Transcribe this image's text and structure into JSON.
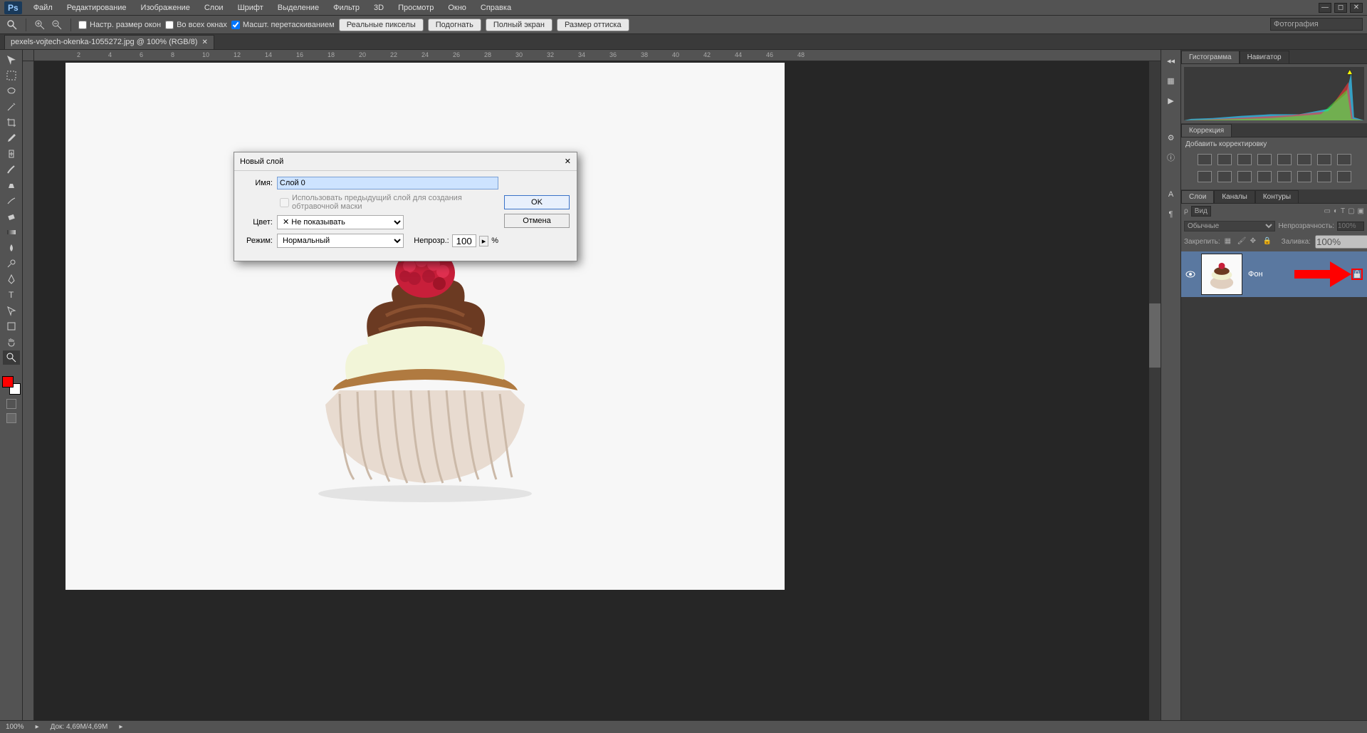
{
  "app": {
    "name": "Ps"
  },
  "menubar": {
    "items": [
      "Файл",
      "Редактирование",
      "Изображение",
      "Слои",
      "Шрифт",
      "Выделение",
      "Фильтр",
      "3D",
      "Просмотр",
      "Окно",
      "Справка"
    ]
  },
  "optionsbar": {
    "fit_checkbox": "Настр. размер окон",
    "all_windows_checkbox": "Во всех окнах",
    "scrubby_checkbox": "Масшт. перетаскиванием",
    "buttons": [
      "Реальные пикселы",
      "Подогнать",
      "Полный экран",
      "Размер оттиска"
    ],
    "search_placeholder": "Фотография"
  },
  "document": {
    "tab_title": "pexels-vojtech-okenka-1055272.jpg @ 100% (RGB/8)"
  },
  "ruler_marks": [
    "2",
    "4",
    "6",
    "8",
    "10",
    "12",
    "14",
    "16",
    "18",
    "20",
    "22",
    "24",
    "26",
    "28",
    "30",
    "32",
    "34",
    "36",
    "38",
    "40",
    "42",
    "44",
    "46",
    "48"
  ],
  "dialog": {
    "title": "Новый слой",
    "name_label": "Имя:",
    "name_value": "Слой 0",
    "clip_checkbox": "Использовать предыдущий слой для создания обтравочной маски",
    "color_label": "Цвет:",
    "color_value": "Не показывать",
    "mode_label": "Режим:",
    "mode_value": "Нормальный",
    "opacity_label": "Непрозр.:",
    "opacity_value": "100",
    "opacity_suffix": "%",
    "ok": "OK",
    "cancel": "Отмена"
  },
  "panels": {
    "histogram_tab": "Гистограмма",
    "navigator_tab": "Навигатор",
    "correction_tab": "Коррекция",
    "correction_hint": "Добавить корректировку",
    "layers_tab": "Слои",
    "channels_tab": "Каналы",
    "paths_tab": "Контуры",
    "layer_kind": "Вид",
    "blend_mode": "Обычные",
    "opacity_label": "Непрозрачность:",
    "opacity_value": "100%",
    "lock_label": "Закрепить:",
    "fill_label": "Заливка:",
    "fill_value": "100%",
    "layer_name": "Фон"
  },
  "statusbar": {
    "zoom": "100%",
    "docinfo": "Док: 4,69M/4,69M"
  }
}
